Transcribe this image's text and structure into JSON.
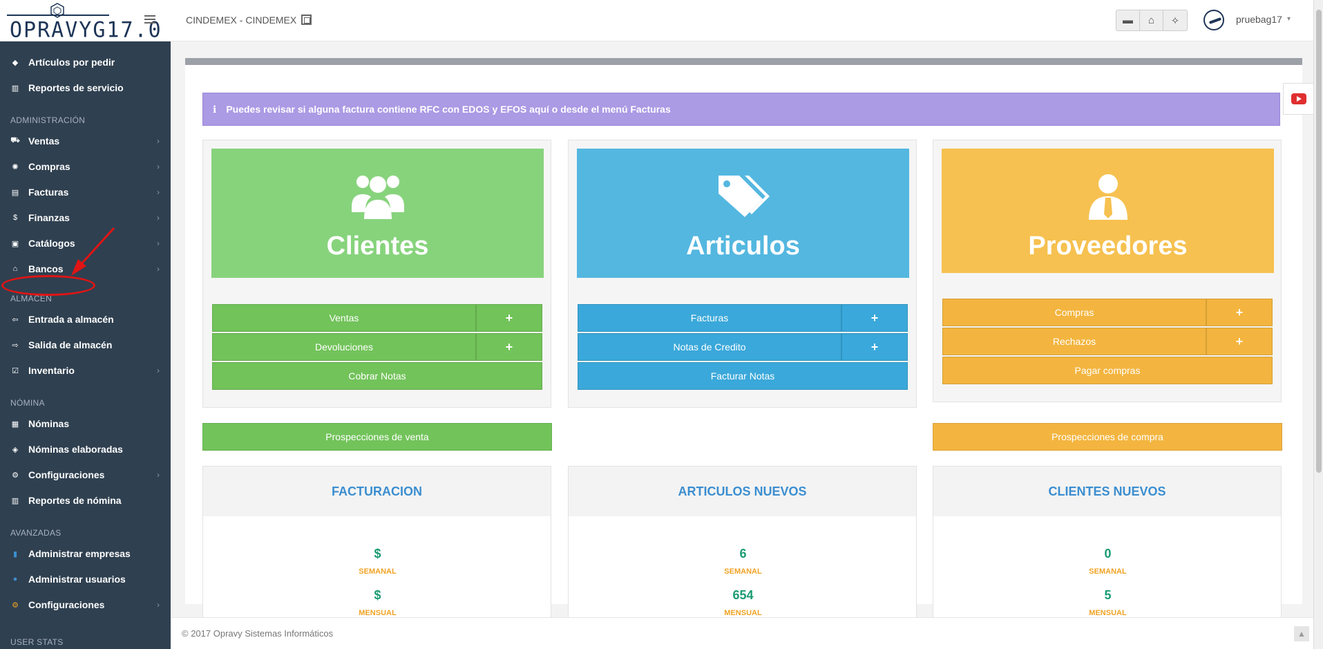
{
  "header": {
    "logo_text": "OPRAVYG17.0",
    "company": "CINDEMEX - CINDEMEX",
    "user_name": "pruebag17",
    "user_caret": "▾",
    "tools": [
      {
        "icon": "briefcase-icon",
        "glyph": "▬"
      },
      {
        "icon": "home-icon",
        "glyph": "⌂"
      },
      {
        "icon": "magic-wand-icon",
        "glyph": "✧"
      }
    ]
  },
  "sidebar": {
    "items_top": [
      {
        "label": "Artículos por pedir",
        "glyph": "◆",
        "icon": "tags-icon"
      },
      {
        "label": "Reportes de servicio",
        "glyph": "▥",
        "icon": "bar-chart-icon"
      }
    ],
    "section_admin": "ADMINISTRACIÓN",
    "items_admin": [
      {
        "label": "Ventas",
        "glyph": "⛟",
        "icon": "cart-icon",
        "chev": "›"
      },
      {
        "label": "Compras",
        "glyph": "✺",
        "icon": "certificate-icon",
        "chev": "›"
      },
      {
        "label": "Facturas",
        "glyph": "▤",
        "icon": "invoice-icon",
        "chev": "›"
      },
      {
        "label": "Finanzas",
        "glyph": "$",
        "icon": "dollar-icon",
        "chev": "›"
      },
      {
        "label": "Catálogos",
        "glyph": "▣",
        "icon": "book-icon",
        "chev": "›"
      },
      {
        "label": "Bancos",
        "glyph": "⌂",
        "icon": "bank-icon",
        "chev": "›"
      }
    ],
    "section_almacen": "ALMACÉN",
    "items_almacen": [
      {
        "label": "Entrada a almacén",
        "glyph": "⇦",
        "icon": "hand-left-icon"
      },
      {
        "label": "Salida de almacén",
        "glyph": "⇨",
        "icon": "hand-right-icon"
      },
      {
        "label": "Inventario",
        "glyph": "☑",
        "icon": "checklist-icon",
        "chev": "›"
      }
    ],
    "section_nomina": "NÓMINA",
    "items_nomina": [
      {
        "label": "Nóminas",
        "glyph": "▦",
        "icon": "table-icon"
      },
      {
        "label": "Nóminas elaboradas",
        "glyph": "◈",
        "icon": "layers-icon"
      },
      {
        "label": "Configuraciones",
        "glyph": "⚙",
        "icon": "cogs-icon",
        "chev": "›"
      },
      {
        "label": "Reportes de nómina",
        "glyph": "▥",
        "icon": "bar-chart-icon"
      }
    ],
    "section_avanzadas": "AVANZADAS",
    "items_avanzadas": [
      {
        "label": "Administrar empresas",
        "glyph": "▮",
        "icon": "building-icon",
        "color": "#3b8ed0"
      },
      {
        "label": "Administrar usuarios",
        "glyph": "●",
        "icon": "user-icon",
        "color": "#3b8ed0"
      },
      {
        "label": "Configuraciones",
        "glyph": "⚙",
        "icon": "cogs-icon",
        "color": "#f0a324",
        "chev": "›"
      }
    ],
    "section_userstats": "USER STATS"
  },
  "alert": {
    "glyph": "ℹ",
    "text": "Puedes revisar si alguna factura contiene RFC con EDOS y EFOS aquí o desde el menú Facturas"
  },
  "panels": {
    "clientes": {
      "title": "Clientes",
      "btn_ventas": "Ventas",
      "btn_devoluciones": "Devoluciones",
      "btn_cobrar": "Cobrar Notas",
      "plus": "+"
    },
    "articulos": {
      "title": "Articulos",
      "btn_facturas": "Facturas",
      "btn_notas": "Notas de Credito",
      "btn_facturar": "Facturar Notas",
      "plus": "+"
    },
    "proveedores": {
      "title": "Proveedores",
      "btn_compras": "Compras",
      "btn_rechazos": "Rechazos",
      "btn_pagar": "Pagar compras",
      "plus": "+"
    }
  },
  "prospecciones": {
    "venta": "Prospecciones de venta",
    "compra": "Prospecciones de compra"
  },
  "stats": {
    "facturacion": {
      "title": "FACTURACION",
      "semanal": "$",
      "mensual": "$"
    },
    "articulos": {
      "title": "ARTICULOS NUEVOS",
      "semanal": "6",
      "mensual": "654"
    },
    "clientes": {
      "title": "CLIENTES NUEVOS",
      "semanal": "0",
      "mensual": "5"
    },
    "label_semanal": "SEMANAL",
    "label_mensual": "MENSUAL"
  },
  "footer": {
    "text": "© 2017 Opravy Sistemas Informáticos",
    "scroll_top": "▲"
  }
}
